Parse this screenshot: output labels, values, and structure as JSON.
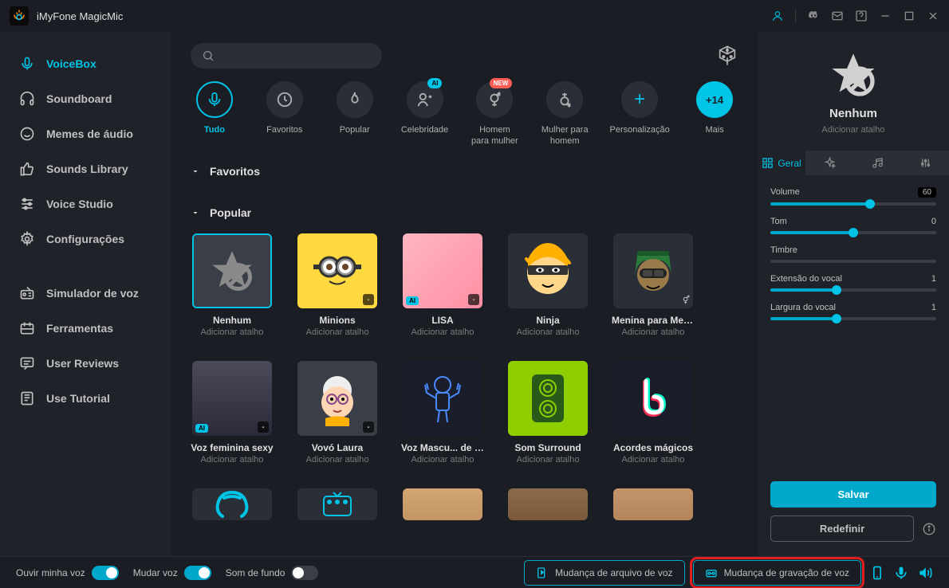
{
  "app": {
    "title": "iMyFone MagicMic"
  },
  "sidebar": {
    "items": [
      {
        "label": "VoiceBox",
        "icon": "mic",
        "active": true
      },
      {
        "label": "Soundboard",
        "icon": "headphones"
      },
      {
        "label": "Memes de áudio",
        "icon": "smile"
      },
      {
        "label": "Sounds Library",
        "icon": "thumbs-up"
      },
      {
        "label": "Voice Studio",
        "icon": "sliders"
      },
      {
        "label": "Configurações",
        "icon": "gear"
      }
    ],
    "items2": [
      {
        "label": "Simulador de voz",
        "icon": "radio"
      },
      {
        "label": "Ferramentas",
        "icon": "tools"
      },
      {
        "label": "User Reviews",
        "icon": "chat"
      },
      {
        "label": "Use Tutorial",
        "icon": "book"
      }
    ]
  },
  "categories": [
    {
      "label": "Tudo",
      "active": true,
      "icon": "mic"
    },
    {
      "label": "Favoritos",
      "icon": "clock"
    },
    {
      "label": "Popular",
      "icon": "fire"
    },
    {
      "label": "Celebridade",
      "icon": "users",
      "badge": "AI"
    },
    {
      "label": "Homem para mulher",
      "icon": "gender",
      "badge": "NEW"
    },
    {
      "label": "Mulher para homem",
      "icon": "gender2"
    },
    {
      "label": "Personalização",
      "icon": "plus"
    },
    {
      "label": "+14",
      "icon": "mais",
      "sublabel": "Mais"
    }
  ],
  "sections": {
    "favoritos": "Favoritos",
    "popular": "Popular"
  },
  "voices_popular": [
    {
      "name": "Nenhum",
      "sub": "Adicionar atalho",
      "art": "nenhum",
      "selected": true
    },
    {
      "name": "Minions",
      "sub": "Adicionar atalho",
      "art": "minion",
      "dl": true
    },
    {
      "name": "LISA",
      "sub": "Adicionar atalho",
      "art": "lisa",
      "ai": true,
      "dl": true
    },
    {
      "name": "Ninja",
      "sub": "Adicionar atalho",
      "art": "ninja"
    },
    {
      "name": "Menina para Menino",
      "sub": "Adicionar atalho",
      "art": "menina",
      "gender": true
    }
  ],
  "voices_row2": [
    {
      "name": "Voz feminina sexy",
      "sub": "Adicionar atalho",
      "art": "sexy",
      "ai": true,
      "dl": true
    },
    {
      "name": "Vovó Laura",
      "sub": "Adicionar atalho",
      "art": "vovo",
      "dl": true
    },
    {
      "name": "Voz Mascu... de Metal",
      "sub": "Adicionar atalho",
      "art": "metal"
    },
    {
      "name": "Som Surround",
      "sub": "Adicionar atalho",
      "art": "surround"
    },
    {
      "name": "Acordes mágicos",
      "sub": "Adicionar atalho",
      "art": "magic"
    }
  ],
  "rightpanel": {
    "name": "Nenhum",
    "sub": "Adicionar atalho",
    "tabs": {
      "geral": "Geral"
    },
    "sliders": {
      "volume": {
        "label": "Volume",
        "value": "60",
        "pct": 60
      },
      "tom": {
        "label": "Tom",
        "value": "0",
        "pct": 50
      },
      "timbre": {
        "label": "Timbre",
        "value": "",
        "pct": 0
      },
      "extensao": {
        "label": "Extensão do vocal",
        "value": "1",
        "pct": 40
      },
      "largura": {
        "label": "Largura do vocal",
        "value": "1",
        "pct": 40
      }
    },
    "save": "Salvar",
    "reset": "Redefinir"
  },
  "bottombar": {
    "ouvir": "Ouvir minha voz",
    "mudar": "Mudar voz",
    "fundo": "Som de fundo",
    "arquivo": "Mudança de arquivo de voz",
    "gravacao": "Mudança de gravação de voz"
  }
}
